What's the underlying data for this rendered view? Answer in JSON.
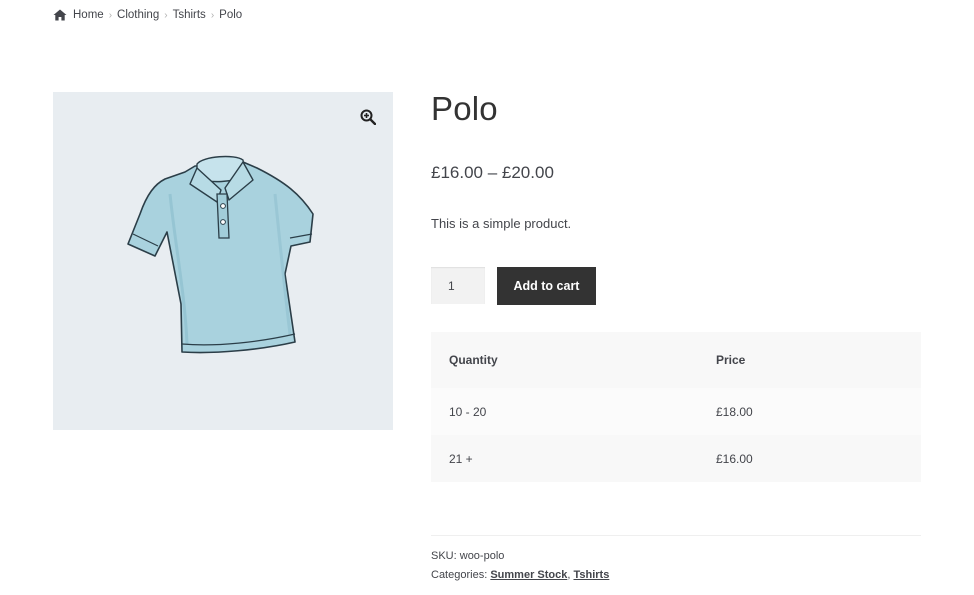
{
  "breadcrumb": {
    "home_icon": "home-icon",
    "items": [
      "Home",
      "Clothing",
      "Tshirts",
      "Polo"
    ],
    "separator": "›"
  },
  "gallery": {
    "zoom_icon": "zoom-in-icon",
    "image_subject": "light blue polo shirt",
    "background": "#e8edf1"
  },
  "product": {
    "title": "Polo",
    "price": "£16.00 – £20.00",
    "description": "This is a simple product."
  },
  "cart": {
    "quantity_value": "1",
    "add_button_label": "Add to cart",
    "button_color": "#333333"
  },
  "pricing_table": {
    "headers": [
      "Quantity",
      "Price"
    ],
    "rows": [
      [
        "10 - 20",
        "£18.00"
      ],
      [
        "21 +",
        "£16.00"
      ]
    ]
  },
  "meta": {
    "sku_label": "SKU:",
    "sku_value": "woo-polo",
    "categories_label": "Categories:",
    "categories": [
      "Summer Stock",
      "Tshirts"
    ],
    "categories_separator": ","
  }
}
